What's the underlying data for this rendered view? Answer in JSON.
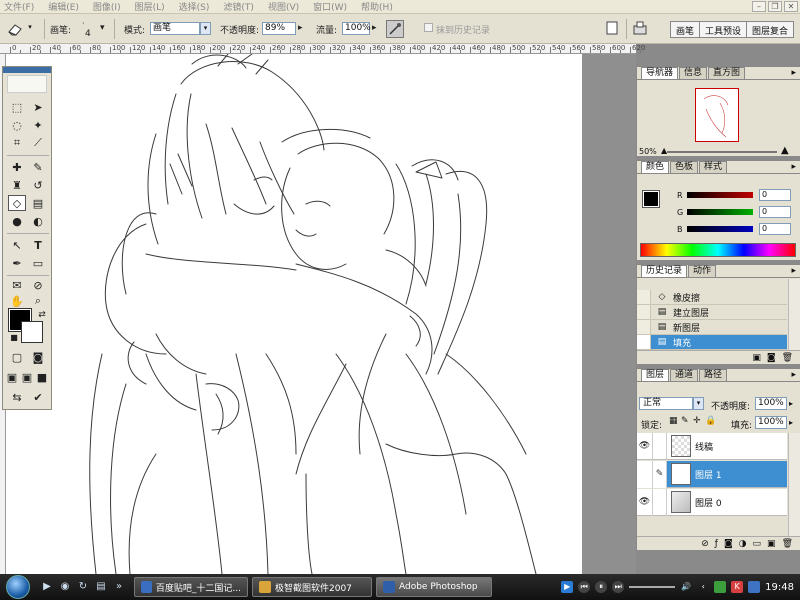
{
  "menubar": {
    "items": [
      "文件(F)",
      "编辑(E)",
      "图像(I)",
      "图层(L)",
      "选择(S)",
      "滤镜(T)",
      "视图(V)",
      "窗口(W)",
      "帮助(H)"
    ]
  },
  "options": {
    "brush_label": "画笔:",
    "brush_size": "4",
    "mode_label": "模式:",
    "mode_value": "画笔",
    "opacity_label": "不透明度:",
    "opacity_value": "89%",
    "flow_label": "流量:",
    "flow_value": "100%",
    "erase_history_label": "抹到历史记录",
    "well_tabs": [
      "画笔",
      "工具预设",
      "图层复合"
    ]
  },
  "ruler": {
    "numbers": [
      "0",
      "20",
      "40",
      "60",
      "80",
      "100",
      "120",
      "140",
      "160",
      "180",
      "200",
      "220",
      "240",
      "260",
      "280",
      "300",
      "320",
      "340",
      "360",
      "380",
      "400",
      "420",
      "440",
      "460",
      "480",
      "500",
      "520",
      "540",
      "560",
      "580",
      "600",
      "620"
    ]
  },
  "navigator_panel": {
    "tabs": [
      "导航器",
      "信息",
      "直方图"
    ],
    "zoom": "50%"
  },
  "color_panel": {
    "tabs": [
      "颜色",
      "色板",
      "样式"
    ],
    "channels": [
      {
        "label": "R",
        "value": "0",
        "color": "#c00000"
      },
      {
        "label": "G",
        "value": "0",
        "color": "#00a000"
      },
      {
        "label": "B",
        "value": "0",
        "color": "#0000c0"
      }
    ]
  },
  "history_panel": {
    "tabs": [
      "历史记录",
      "动作"
    ],
    "items": [
      {
        "label": "橡皮擦",
        "icon": "eraser-icon",
        "selected": false
      },
      {
        "label": "建立图层",
        "icon": "document-icon",
        "selected": false
      },
      {
        "label": "新图层",
        "icon": "document-icon",
        "selected": false
      },
      {
        "label": "填充",
        "icon": "document-icon",
        "selected": true
      }
    ]
  },
  "layers_panel": {
    "tabs": [
      "图层",
      "通道",
      "路径"
    ],
    "blend_mode": "正常",
    "opacity_label": "不透明度:",
    "opacity_value": "100%",
    "lock_label": "锁定:",
    "fill_label": "填充:",
    "fill_value": "100%",
    "layers": [
      {
        "name": "线稿",
        "visible": true,
        "selected": false
      },
      {
        "name": "图层 1",
        "visible": true,
        "selected": true
      },
      {
        "name": "图层 0",
        "visible": true,
        "selected": false
      }
    ]
  },
  "taskbar": {
    "tasks": [
      {
        "label": "百度贴吧_十二国记...",
        "color": "#3a6ec0",
        "active": false
      },
      {
        "label": "极智截图软件2007",
        "color": "#d9a53a",
        "active": false
      },
      {
        "label": "Adobe Photoshop",
        "color": "#2f5fa8",
        "active": true
      }
    ],
    "clock": "19:48"
  }
}
